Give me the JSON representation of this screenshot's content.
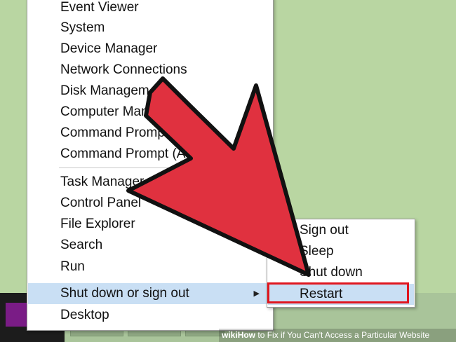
{
  "menu": {
    "items": [
      {
        "label": "Event Viewer"
      },
      {
        "label": "System"
      },
      {
        "label": "Device Manager"
      },
      {
        "label": "Network Connections"
      },
      {
        "label": "Disk Managem"
      },
      {
        "label": "Computer Man"
      },
      {
        "label": "Command Prompt"
      },
      {
        "label": "Command Prompt (A"
      },
      {
        "label": "Task Manager"
      },
      {
        "label": "Control Panel"
      },
      {
        "label": "File Explorer"
      },
      {
        "label": "Search"
      },
      {
        "label": "Run"
      },
      {
        "label": "Shut down or sign out"
      },
      {
        "label": "Desktop"
      }
    ],
    "submenu_arrow": "▶"
  },
  "submenu": {
    "items": [
      {
        "label": "Sign out"
      },
      {
        "label": "Sleep"
      },
      {
        "label": "Shut down"
      },
      {
        "label": "Restart"
      }
    ]
  },
  "colors": {
    "highlight": "#c9dff4",
    "arrow_fill": "#e0313f",
    "outline": "#e0161f",
    "desktop": "#b9d6a2"
  },
  "watermark": {
    "logo": "wiki",
    "bold": "How",
    "title": " to Fix if You Can't Access a Particular Website"
  }
}
